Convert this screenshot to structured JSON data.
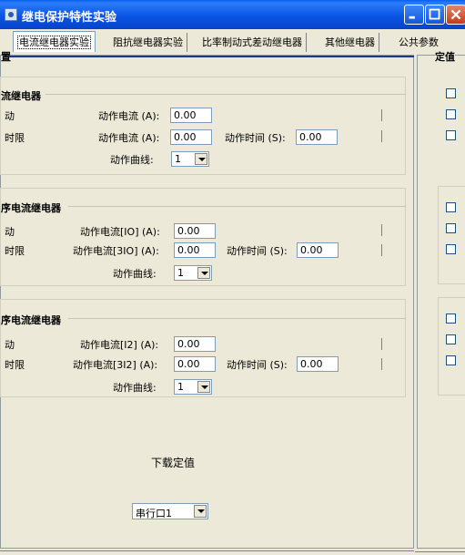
{
  "window": {
    "title": "继电保护特性实验"
  },
  "tabs": [
    "电流继电器实验",
    "阻抗继电器实验",
    "比率制动式差动继电器",
    "其他继电器",
    "公共参数"
  ],
  "left_panel": {
    "title_fragment": "置"
  },
  "right_panel": {
    "title_fragment": "定值"
  },
  "group1": {
    "title": "流继电器",
    "row1_label": "动",
    "row2_label": "时限",
    "current_label": "动作电流 (A):",
    "current_value": "0.00",
    "current2_label": "动作电流 (A):",
    "current2_value": "0.00",
    "time_label": "动作时间 (S):",
    "time_value": "0.00",
    "curve_label": "动作曲线:",
    "curve_value": "1"
  },
  "group2": {
    "title": "序电流继电器",
    "row1_label": "动",
    "row2_label": "时限",
    "current_label": "动作电流[IO] (A):",
    "current_value": "0.00",
    "current2_label": "动作电流[3IO] (A):",
    "current2_value": "0.00",
    "time_label": "动作时间 (S):",
    "time_value": "0.00",
    "curve_label": "动作曲线:",
    "curve_value": "1"
  },
  "group3": {
    "title": "序电流继电器",
    "row1_label": "动",
    "row2_label": "时限",
    "current_label": "动作电流[I2] (A):",
    "current_value": "0.00",
    "current2_label": "动作电流[3I2] (A):",
    "current2_value": "0.00",
    "time_label": "动作时间 (S):",
    "time_value": "0.00",
    "curve_label": "动作曲线:",
    "curve_value": "1"
  },
  "download_label": "下载定值",
  "port": {
    "value": "串行口1"
  },
  "colors": {
    "titlebar": "#0a5ef0",
    "window_bg": "#ece9d8",
    "close_button": "#c8391a"
  }
}
